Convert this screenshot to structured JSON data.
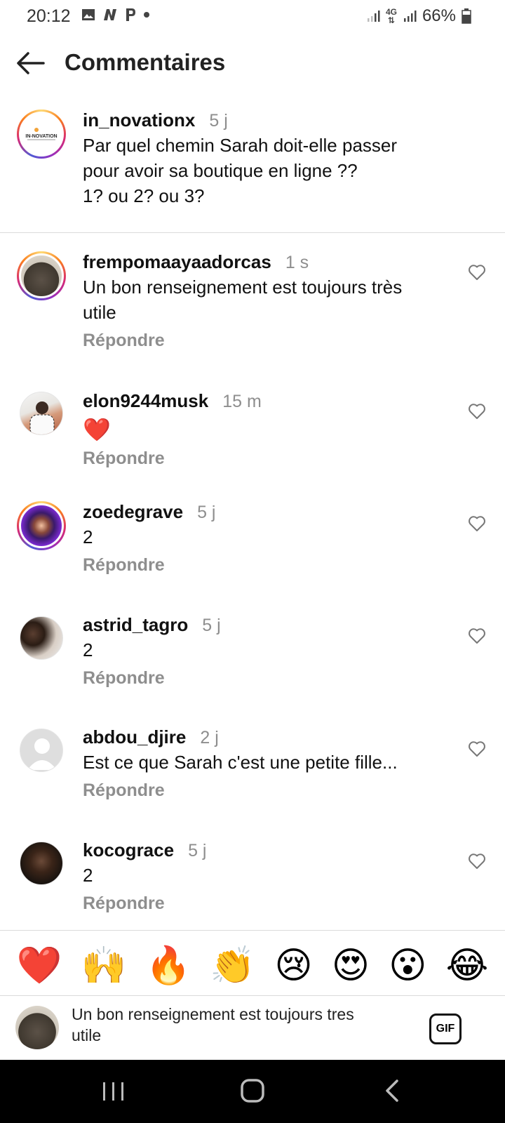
{
  "status_bar": {
    "time": "20:12",
    "battery": "66%",
    "network": "4G"
  },
  "header": {
    "title": "Commentaires",
    "back_icon": "arrow-left-icon"
  },
  "caption": {
    "username": "in_novationx",
    "time": "5 j",
    "lines": [
      "Par quel chemin Sarah doit-elle passer",
      "pour avoir sa boutique en ligne ??",
      "1? ou 2? ou 3?"
    ],
    "avatar_text": "IN-NOVATION"
  },
  "reply_label": "Répondre",
  "comments": [
    {
      "username": "frempomaayaadorcas",
      "time": "1 s",
      "lines": [
        "Un bon renseignement est toujours très",
        "utile"
      ]
    },
    {
      "username": "elon9244musk",
      "time": "15 m",
      "lines": [
        "❤️"
      ]
    },
    {
      "username": "zoedegrave",
      "time": "5 j",
      "lines": [
        "2"
      ]
    },
    {
      "username": "astrid_tagro",
      "time": "5 j",
      "lines": [
        "2"
      ]
    },
    {
      "username": "abdou_djire",
      "time": "2 j",
      "lines": [
        "Est ce que Sarah c'est une petite fille..."
      ]
    },
    {
      "username": "kocograce",
      "time": "5 j",
      "lines": [
        "2"
      ]
    }
  ],
  "emoji_bar": [
    "❤️",
    "🙌",
    "🔥",
    "👏",
    "😢",
    "😍",
    "😮",
    "😂"
  ],
  "composer": {
    "lines": [
      "Un bon renseignement est toujours tres",
      "utile"
    ],
    "gif_label": "GIF"
  },
  "colors": {
    "meta_grey": "#8e8e8e",
    "divider": "#dbdbdb",
    "heart_red": "#e0242f"
  }
}
